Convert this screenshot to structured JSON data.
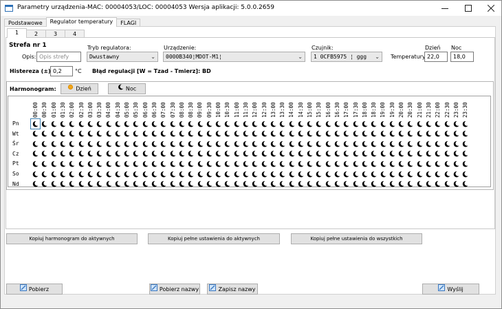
{
  "window": {
    "title": "Parametry urządzenia-MAC: 00004053/LOC: 00004053 Wersja aplikacji: 5.0.0.2659",
    "minimize_icon": "minimize-icon",
    "maximize_icon": "maximize-icon",
    "close_icon": "close-icon"
  },
  "main_tabs": [
    "Podstawowe",
    "Regulator temperatury",
    "FLAGI"
  ],
  "active_main_tab": 1,
  "zone_tabs": [
    "1",
    "2",
    "3",
    "4"
  ],
  "active_zone_tab": 0,
  "zone": {
    "title": "Strefa nr 1",
    "opis_label": "Opis:",
    "opis_placeholder": "Opis strefy",
    "tryb_label": "Tryb regulatora:",
    "tryb_value": "Dwustawny",
    "urzadzenie_label": "Urządzenie:",
    "urzadzenie_value": "0000B340¦MDOT-M1¦",
    "czujnik_label": "Czujnik:",
    "czujnik_value": "1 0CFB5975 ¦ ggg",
    "temperatury_label": "Temperatury:",
    "dzien_label": "Dzień",
    "noc_label": "Noc",
    "dzien_value": "22,0",
    "noc_value": "18,0",
    "histereza_label": "Histereza (±):",
    "histereza_value": "0,2",
    "histereza_unit": "°C",
    "blad_text": "Błąd regulacji [W = Tzad - Tmierz]: BD"
  },
  "harmonogram": {
    "label": "Harmonogram:",
    "dzien_button": "Dzień",
    "noc_button": "Noc",
    "times": [
      "00:00",
      "00:30",
      "01:00",
      "01:30",
      "02:00",
      "02:30",
      "03:00",
      "03:30",
      "04:00",
      "04:30",
      "05:00",
      "05:30",
      "06:00",
      "06:30",
      "07:00",
      "07:30",
      "08:00",
      "08:30",
      "09:00",
      "09:30",
      "10:00",
      "10:30",
      "11:00",
      "11:30",
      "12:00",
      "12:30",
      "13:00",
      "13:30",
      "14:00",
      "14:30",
      "15:00",
      "15:30",
      "16:00",
      "16:30",
      "17:00",
      "17:30",
      "18:00",
      "18:30",
      "19:00",
      "19:30",
      "20:00",
      "20:30",
      "21:00",
      "21:30",
      "22:00",
      "22:30",
      "23:00",
      "23:30"
    ],
    "days": [
      "Pn",
      "Wt",
      "Śr",
      "Cz",
      "Pt",
      "So",
      "Nd"
    ],
    "cell_icon": "moon-icon"
  },
  "copy_buttons": {
    "harmonogram": "Kopiuj harmonogram do aktywnych",
    "pelne_aktywnych": "Kopiuj pełne ustawienia do aktywnych",
    "pelne_wszystkich": "Kopiuj pełne ustawienia do wszystkich"
  },
  "bottom_buttons": {
    "pobierz": "Pobierz",
    "pobierz_nazwy": "Pobierz nazwy",
    "zapisz_nazwy": "Zapisz nazwy",
    "wyslij": "Wyślij"
  }
}
